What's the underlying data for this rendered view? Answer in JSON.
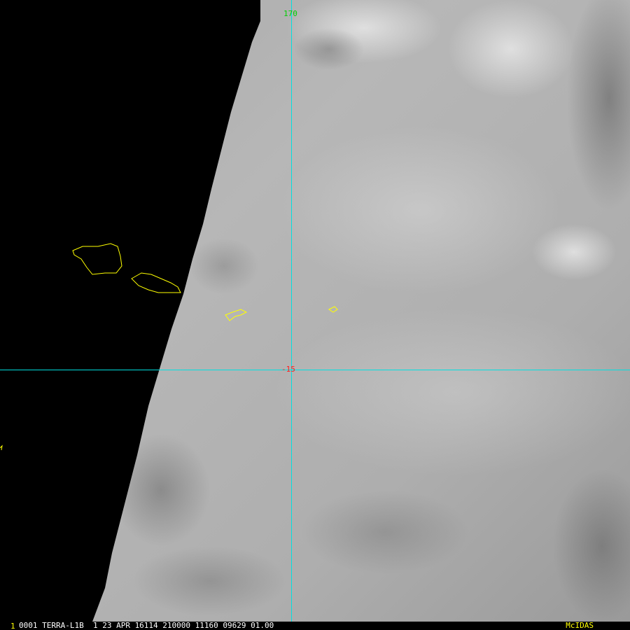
{
  "colors": {
    "grid_line": "#00e0e0",
    "coastline": "#ffff00",
    "lon_label": "#00d000",
    "lat_label": "#ff2020",
    "frame_number": "#ffff00",
    "frame_info": "#ffffff",
    "brand": "#ffff00"
  },
  "grid": {
    "longitude_label": "170",
    "latitude_label": "-15"
  },
  "status_bar": {
    "frame_number": "1",
    "frame_info": "0001 TERRA-L1B  1 23 APR 16114 210000 11160 09629 01.00",
    "brand": "McIDAS"
  }
}
